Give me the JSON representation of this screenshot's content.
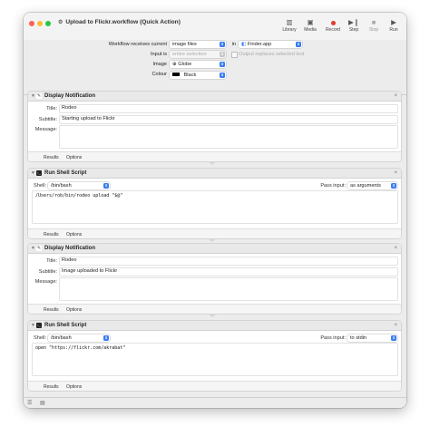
{
  "window": {
    "title": "Upload to Flickr.workflow (Quick Action)"
  },
  "toolbar": {
    "library": "Library",
    "media": "Media",
    "record": "Record",
    "step": "Step",
    "stop": "Stop",
    "run": "Run"
  },
  "workflow": {
    "receives_label": "Workflow receives current",
    "receives_value": "image files",
    "in_label": "in",
    "in_value": "Finder.app",
    "input_label": "Input is",
    "input_value": "entire selection",
    "output_replaces": "Output replaces selected text",
    "image_label": "Image",
    "image_value": "Globe",
    "colour_label": "Colour",
    "colour_value": "Black",
    "colour_swatch": "#000000"
  },
  "actions": [
    {
      "title": "Display Notification",
      "title_label": "Title:",
      "title_value": "Rodeo",
      "subtitle_label": "Subtitle:",
      "subtitle_value": "Starting upload to Flickr",
      "message_label": "Message:",
      "results": "Results",
      "options": "Options"
    },
    {
      "title": "Run Shell Script",
      "shell_label": "Shell:",
      "shell_value": "/bin/bash",
      "pass_label": "Pass input:",
      "pass_value": "as arguments",
      "script": "/Users/rob/bin/rodeo upload \"$@\"",
      "results": "Results",
      "options": "Options"
    },
    {
      "title": "Display Notification",
      "title_label": "Title:",
      "title_value": "Rodeo",
      "subtitle_label": "Subtitle:",
      "subtitle_value": "Image uploaded to Flickr",
      "message_label": "Message:",
      "results": "Results",
      "options": "Options"
    },
    {
      "title": "Run Shell Script",
      "shell_label": "Shell:",
      "shell_value": "/bin/bash",
      "pass_label": "Pass input:",
      "pass_value": "to stdin",
      "script": "open \"https://flickr.com/akrabat\"",
      "results": "Results",
      "options": "Options"
    }
  ]
}
